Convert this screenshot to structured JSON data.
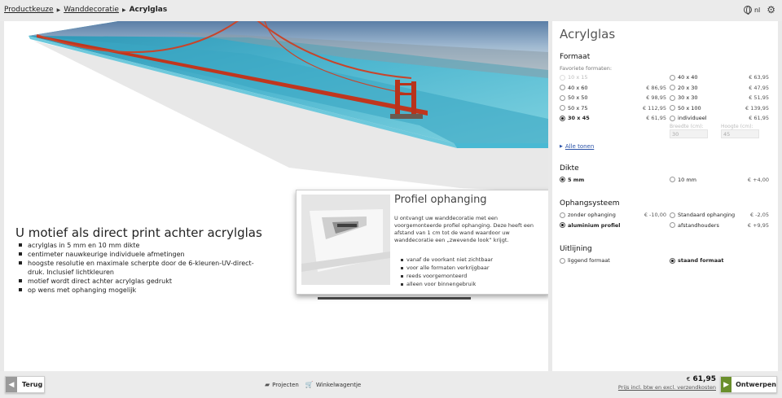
{
  "breadcrumb": {
    "items": [
      "Productkeuze",
      "Wanddecoratie"
    ],
    "current": "Acrylglas"
  },
  "topbar": {
    "language": "nl"
  },
  "preview": {
    "title": "U motief als direct print achter acrylglas",
    "features": [
      "acrylglas in 5 mm en 10 mm dikte",
      "centimeter nauwkeurige individuele afmetingen",
      "hoogste resolutie en maximale scherpte door de 6-kleuren-UV-direct-druk. Inclusief lichtkleuren",
      "motief wordt direct achter acrylglas gedrukt",
      "op wens met ophanging mogelijk"
    ],
    "profiel": {
      "title": "Profiel ophanging",
      "description": "U ontvangt uw wanddecoratie met een voorgemonteerde profiel ophanging. Deze heeft een afstand van 1 cm tot de wand waardoor uw wanddecoratie een „zwevende look” krijgt.",
      "bullets": [
        "vanaf de voorkant niet zichtbaar",
        "voor alle formaten verkrijgbaar",
        "reeds voorgemonteerd",
        "alleen voor binnengebruik"
      ]
    }
  },
  "panel": {
    "title": "Acrylglas",
    "formaat": {
      "title": "Formaat",
      "favorites_label": "Favoriete formaten:",
      "options": [
        {
          "label": "10 x 15",
          "price": "",
          "state": "disabled"
        },
        {
          "label": "40 x 40",
          "price": "€ 63,95",
          "state": ""
        },
        {
          "label": "40 x 60",
          "price": "€ 86,95",
          "state": ""
        },
        {
          "label": "20 x 30",
          "price": "€ 47,95",
          "state": ""
        },
        {
          "label": "50 x 50",
          "price": "€ 98,95",
          "state": ""
        },
        {
          "label": "30 x 30",
          "price": "€ 51,95",
          "state": ""
        },
        {
          "label": "50 x 75",
          "price": "€ 112,95",
          "state": ""
        },
        {
          "label": "50 x 100",
          "price": "€ 139,95",
          "state": ""
        },
        {
          "label": "30 x 45",
          "price": "€ 61,95",
          "state": "selected"
        },
        {
          "label": "individueel",
          "price": "€ 61,95",
          "state": ""
        }
      ],
      "width_label": "Breedte (cm):",
      "width_value": "30",
      "height_label": "Hoogte (cm):",
      "height_value": "45",
      "show_all": "Alle tonen"
    },
    "dikte": {
      "title": "Dikte",
      "options": [
        {
          "label": "5 mm",
          "price": "",
          "state": "selected"
        },
        {
          "label": "10 mm",
          "price": "€ +4,00",
          "state": ""
        }
      ]
    },
    "ophangsysteem": {
      "title": "Ophangsysteem",
      "options": [
        {
          "label": "zonder ophanging",
          "price": "€ -10,00",
          "state": ""
        },
        {
          "label": "Standaard ophanging",
          "price": "€ -2,05",
          "state": ""
        },
        {
          "label": "aluminium profiel",
          "price": "",
          "state": "selected"
        },
        {
          "label": "afstandhouders",
          "price": "€ +9,95",
          "state": ""
        }
      ]
    },
    "uitlijning": {
      "title": "Uitlijning",
      "options": [
        {
          "label": "liggend formaat",
          "price": "",
          "state": ""
        },
        {
          "label": "staand formaat",
          "price": "",
          "state": "selected"
        }
      ]
    }
  },
  "footer": {
    "back_label": "Terug",
    "projects_label": "Projecten",
    "cart_label": "Winkelwagentje",
    "price_currency": "€",
    "price_value": "61,95",
    "price_note": "Prijs incl. btw en excl. verzendkosten",
    "design_label": "Ontwerpen"
  },
  "colors": {
    "accent_green": "#6a8f2c",
    "link_blue": "#2a52a8",
    "back_gray": "#9a9a9a"
  }
}
